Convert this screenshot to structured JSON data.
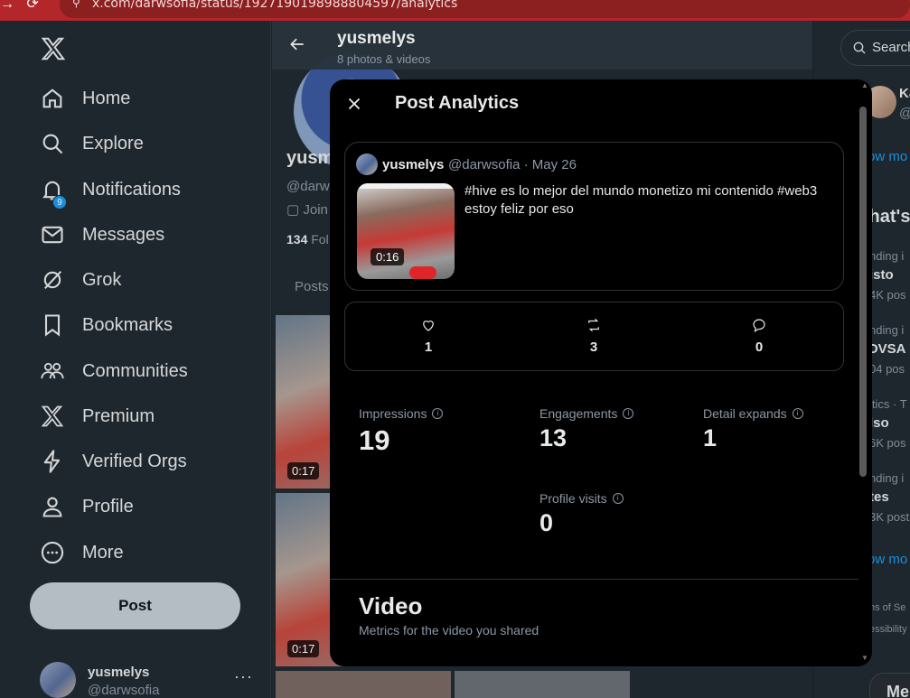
{
  "browser": {
    "url": "x.com/darwsofia/status/1927190198988804597/analytics"
  },
  "sidebar": {
    "notifications_badge": "9",
    "items": [
      {
        "label": "Home",
        "icon": "home-icon"
      },
      {
        "label": "Explore",
        "icon": "search-icon"
      },
      {
        "label": "Notifications",
        "icon": "bell-icon"
      },
      {
        "label": "Messages",
        "icon": "envelope-icon"
      },
      {
        "label": "Grok",
        "icon": "grok-icon"
      },
      {
        "label": "Bookmarks",
        "icon": "bookmark-icon"
      },
      {
        "label": "Communities",
        "icon": "communities-icon"
      },
      {
        "label": "Premium",
        "icon": "x-logo-icon"
      },
      {
        "label": "Verified Orgs",
        "icon": "lightning-icon"
      },
      {
        "label": "Profile",
        "icon": "person-icon"
      },
      {
        "label": "More",
        "icon": "more-circle-icon"
      }
    ],
    "post_button": "Post",
    "account": {
      "name": "yusmelys",
      "handle": "@darwsofia",
      "menu": "···"
    }
  },
  "main": {
    "header_name": "yusmelys",
    "header_sub": "8 photos & videos",
    "profile_name": "yusm",
    "profile_handle": "@darw",
    "joined": "Join",
    "following_count": "134",
    "following_label": "Fol",
    "tab": "Posts",
    "thumb_durations": [
      "0:17",
      "0:17"
    ]
  },
  "right": {
    "search_placeholder": "Search",
    "who_name": "Ka",
    "who_handle": "@",
    "show_more_1": "ow mo",
    "whats": "/hat's",
    "trends": [
      {
        "context": "nding i",
        "name": "isto",
        "posts": "4K pos"
      },
      {
        "context": "nding i",
        "name": "OVSA",
        "posts": "04 pos"
      },
      {
        "context": "itics · T",
        "name": "lso",
        "posts": "6K pos"
      },
      {
        "context": "nding i",
        "name": "tes",
        "posts": "3K post"
      }
    ],
    "show_more_2": "ow mo",
    "footer_1": "ns of Se",
    "footer_2": "essibility",
    "bottom_btn": "Me"
  },
  "modal": {
    "title": "Post Analytics",
    "post": {
      "name": "yusmelys",
      "meta": "@darwsofia · May 26",
      "text": "#hive es lo mejor del mundo monetizo mi contenido #web3 estoy feliz por eso",
      "duration": "0:16"
    },
    "engagement": {
      "likes": "1",
      "reposts": "3",
      "replies": "0"
    },
    "metrics": {
      "impressions_label": "Impressions",
      "impressions": "19",
      "engagements_label": "Engagements",
      "engagements": "13",
      "detail_label": "Detail expands",
      "detail": "1",
      "profile_label": "Profile visits",
      "profile": "0"
    },
    "video_title": "Video",
    "video_sub": "Metrics for the video you shared"
  },
  "colors": {
    "accent": "#1d9bf0",
    "modal_bg": "#000000",
    "page_bg": "#212b32",
    "browser_bar": "#b3262a"
  }
}
